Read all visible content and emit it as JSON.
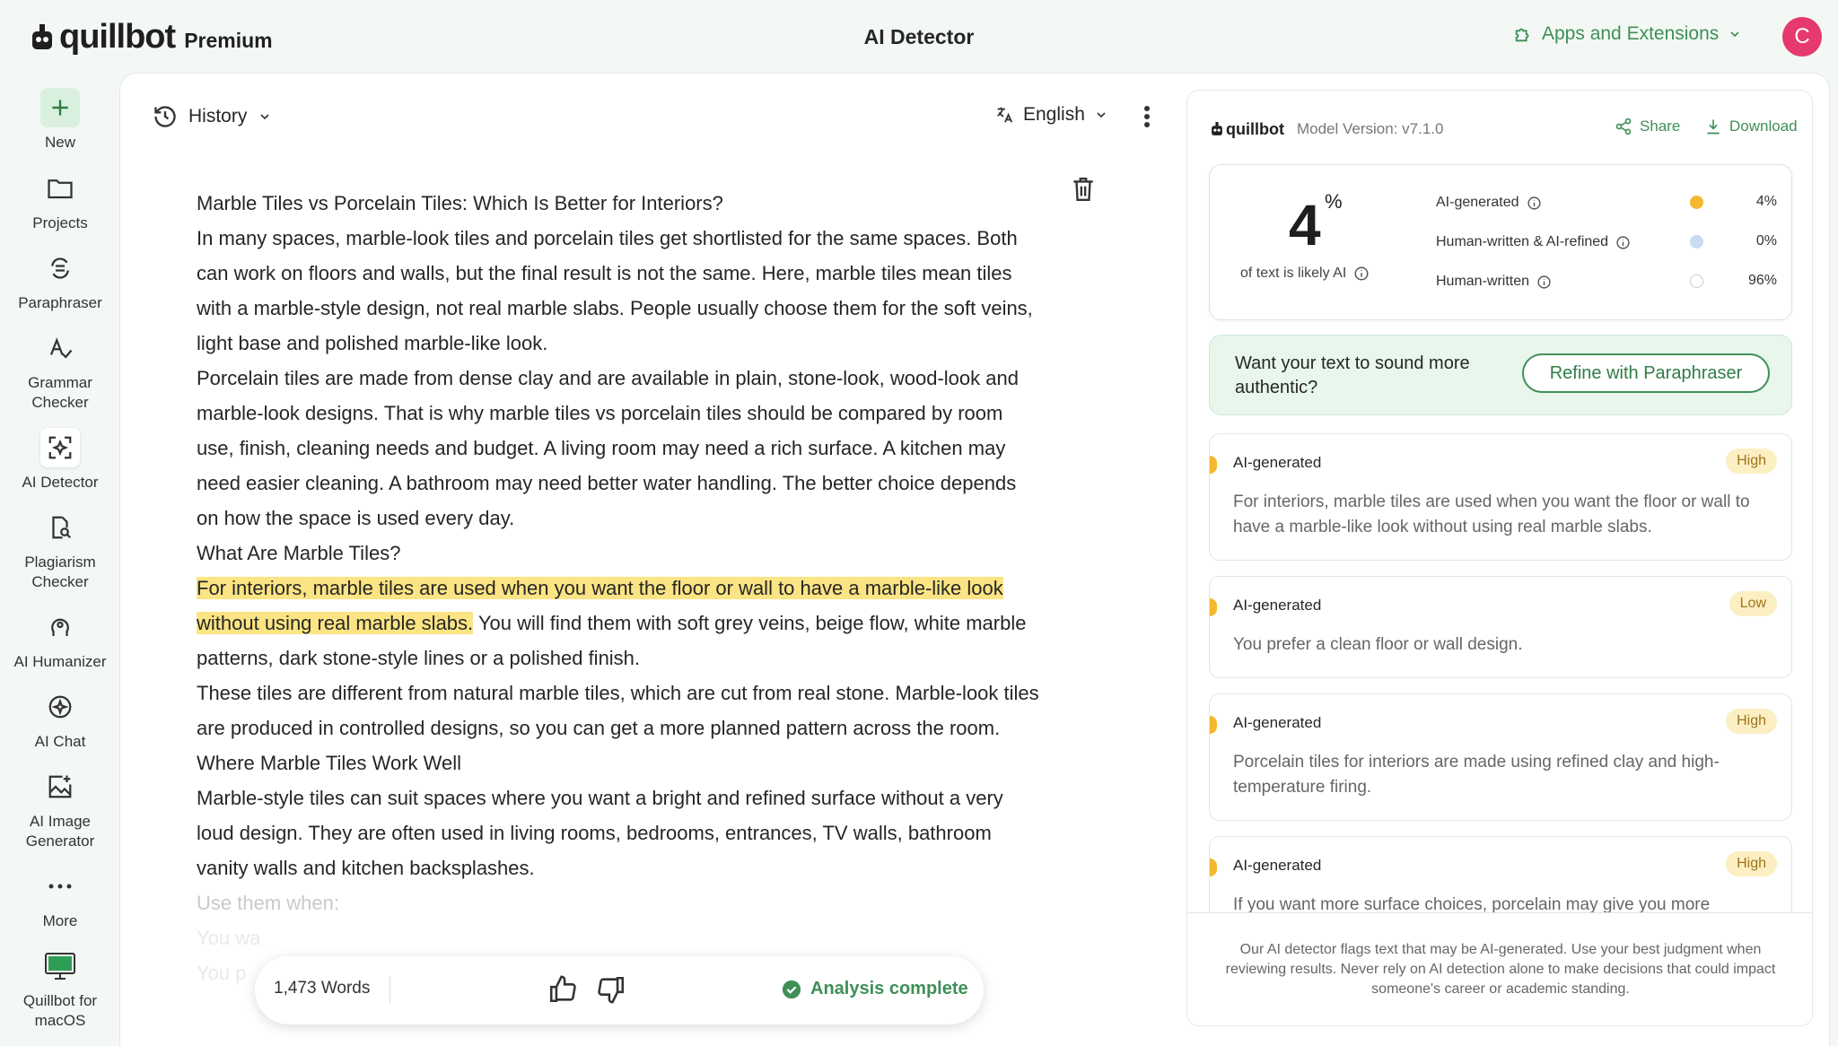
{
  "app": {
    "brand": "quillbot",
    "tier": "Premium",
    "title": "AI Detector",
    "apps_ext_label": "Apps and Extensions",
    "avatar_initial": "C",
    "accent_color": "#3f8f57"
  },
  "sidebar": {
    "items": [
      {
        "label": "New",
        "icon": "plus-icon"
      },
      {
        "label": "Projects",
        "icon": "folder-icon"
      },
      {
        "label": "Paraphraser",
        "icon": "paraphraser-icon"
      },
      {
        "label": "Grammar Checker",
        "icon": "grammar-icon"
      },
      {
        "label": "AI Detector",
        "icon": "ai-detector-icon"
      },
      {
        "label": "Plagiarism Checker",
        "icon": "plagiarism-icon"
      },
      {
        "label": "AI Humanizer",
        "icon": "humanizer-icon"
      },
      {
        "label": "AI Chat",
        "icon": "chat-icon"
      },
      {
        "label": "AI Image Generator",
        "icon": "image-generator-icon"
      },
      {
        "label": "More",
        "icon": "more-icon"
      },
      {
        "label": "Quillbot for macOS",
        "icon": "macos-icon"
      }
    ]
  },
  "editor": {
    "history_label": "History",
    "language_label": "English",
    "lines": [
      "Marble Tiles vs Porcelain Tiles: Which Is Better for Interiors?",
      "In many spaces, marble-look tiles and porcelain tiles get shortlisted for the same spaces. Both can work on floors and walls, but the final result is not the same. Here, marble tiles mean tiles with a marble-style design, not real marble slabs. People usually choose them for the soft veins, light base and polished marble-like look.",
      "Porcelain tiles are made from dense clay and are available in plain, stone-look, wood-look and marble-look designs. That is why marble tiles vs porcelain tiles should be compared by room use, finish, cleaning needs and budget. A living room may need a rich surface. A kitchen may need easier cleaning. A bathroom may need better water handling. The better choice depends on how the space is used every day.",
      "What Are Marble Tiles?"
    ],
    "highlight_text": "For interiors, marble tiles are used when you want the floor or wall to have a marble-like look without using real marble slabs.",
    "after_highlight": " You will find them with soft grey veins, beige flow, white marble patterns, dark stone-style lines or a polished finish.",
    "lines2": [
      "These tiles are different from natural marble tiles, which are cut from real stone. Marble-look tiles are produced in controlled designs, so you can get a more planned pattern across the room.",
      "Where Marble Tiles Work Well",
      "Marble-style tiles can suit spaces where you want a bright and refined surface without a very loud design. They are often used in living rooms, bedrooms, entrances, TV walls, bathroom vanity walls and kitchen backsplashes."
    ],
    "faded_line": "Use them when:",
    "faded_line2": "You wa",
    "faded_line3": "You p",
    "word_count": "1,473 Words",
    "status": "Analysis complete"
  },
  "panel": {
    "logo": "quillbot",
    "model_version": "Model Version: v7.1.0",
    "share_label": "Share",
    "download_label": "Download",
    "score": "4",
    "score_unit": "%",
    "score_sub": "of text is likely AI",
    "breakdown": [
      {
        "label": "AI-generated",
        "value": "4%",
        "color": "#f3b82e"
      },
      {
        "label": "Human-written & AI-refined",
        "value": "0%",
        "color": "#c9daf3"
      },
      {
        "label": "Human-written",
        "value": "96%",
        "color": "#ffffff"
      }
    ],
    "refine_prompt": "Want your text to sound more authentic?",
    "refine_button": "Refine with Paraphraser",
    "results": [
      {
        "label": "AI-generated",
        "badge": "High",
        "text": "For interiors, marble tiles are used when you want the floor or wall to have a marble-like look without using real marble slabs."
      },
      {
        "label": "AI-generated",
        "badge": "Low",
        "text": "You prefer a clean floor or wall design."
      },
      {
        "label": "AI-generated",
        "badge": "High",
        "text": "Porcelain tiles for interiors are made using refined clay and high-temperature firing."
      },
      {
        "label": "AI-generated",
        "badge": "High",
        "text": "If you want more surface choices, porcelain may give you more"
      }
    ],
    "disclaimer": "Our AI detector flags text that may be AI-generated. Use your best judgment when reviewing results. Never rely on AI detection alone to make decisions that could impact someone's career or academic standing."
  }
}
